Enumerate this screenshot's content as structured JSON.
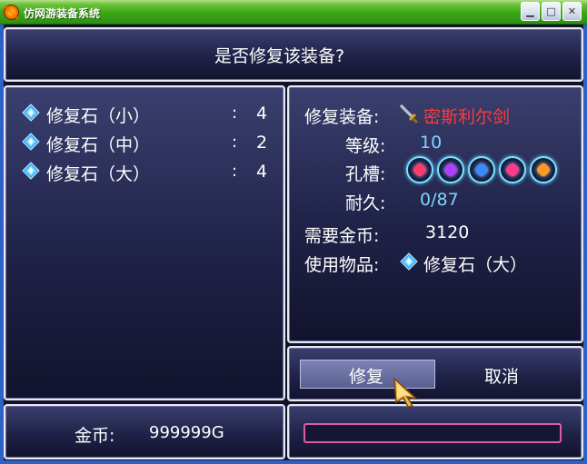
{
  "window": {
    "title": "仿网游装备系统",
    "buttons": {
      "minimize": "▁",
      "maximize": "□",
      "close": "✕"
    }
  },
  "dialog": {
    "prompt": "是否修复该装备?"
  },
  "inventory": {
    "items": [
      {
        "name": "修复石（小）",
        "sep": ":",
        "count": "4"
      },
      {
        "name": "修复石（中）",
        "sep": ":",
        "count": "2"
      },
      {
        "name": "修复石（大）",
        "sep": ":",
        "count": "4"
      }
    ]
  },
  "equipment": {
    "label_equip": "修复装备:",
    "equip_name": "密斯利尔剑",
    "label_level": "等级:",
    "level": "10",
    "label_slots": "孔槽:",
    "slot_colors": [
      "#ff3a6a",
      "#b040ff",
      "#3a8aff",
      "#ff3a8a",
      "#ff9a20"
    ],
    "label_durability": "耐久:",
    "durability": "0/87",
    "label_gold_needed": "需要金币:",
    "gold_needed": "3120",
    "label_use_item": "使用物品:",
    "use_item": "修复石（大）"
  },
  "actions": {
    "repair_label": "修复",
    "cancel_label": "取消"
  },
  "wallet": {
    "label": "金币:",
    "amount": "999999G"
  },
  "colors": {
    "accent_cyan": "#7fd4ff",
    "item_red": "#ff3a3a",
    "input_border": "#e05ca0"
  }
}
